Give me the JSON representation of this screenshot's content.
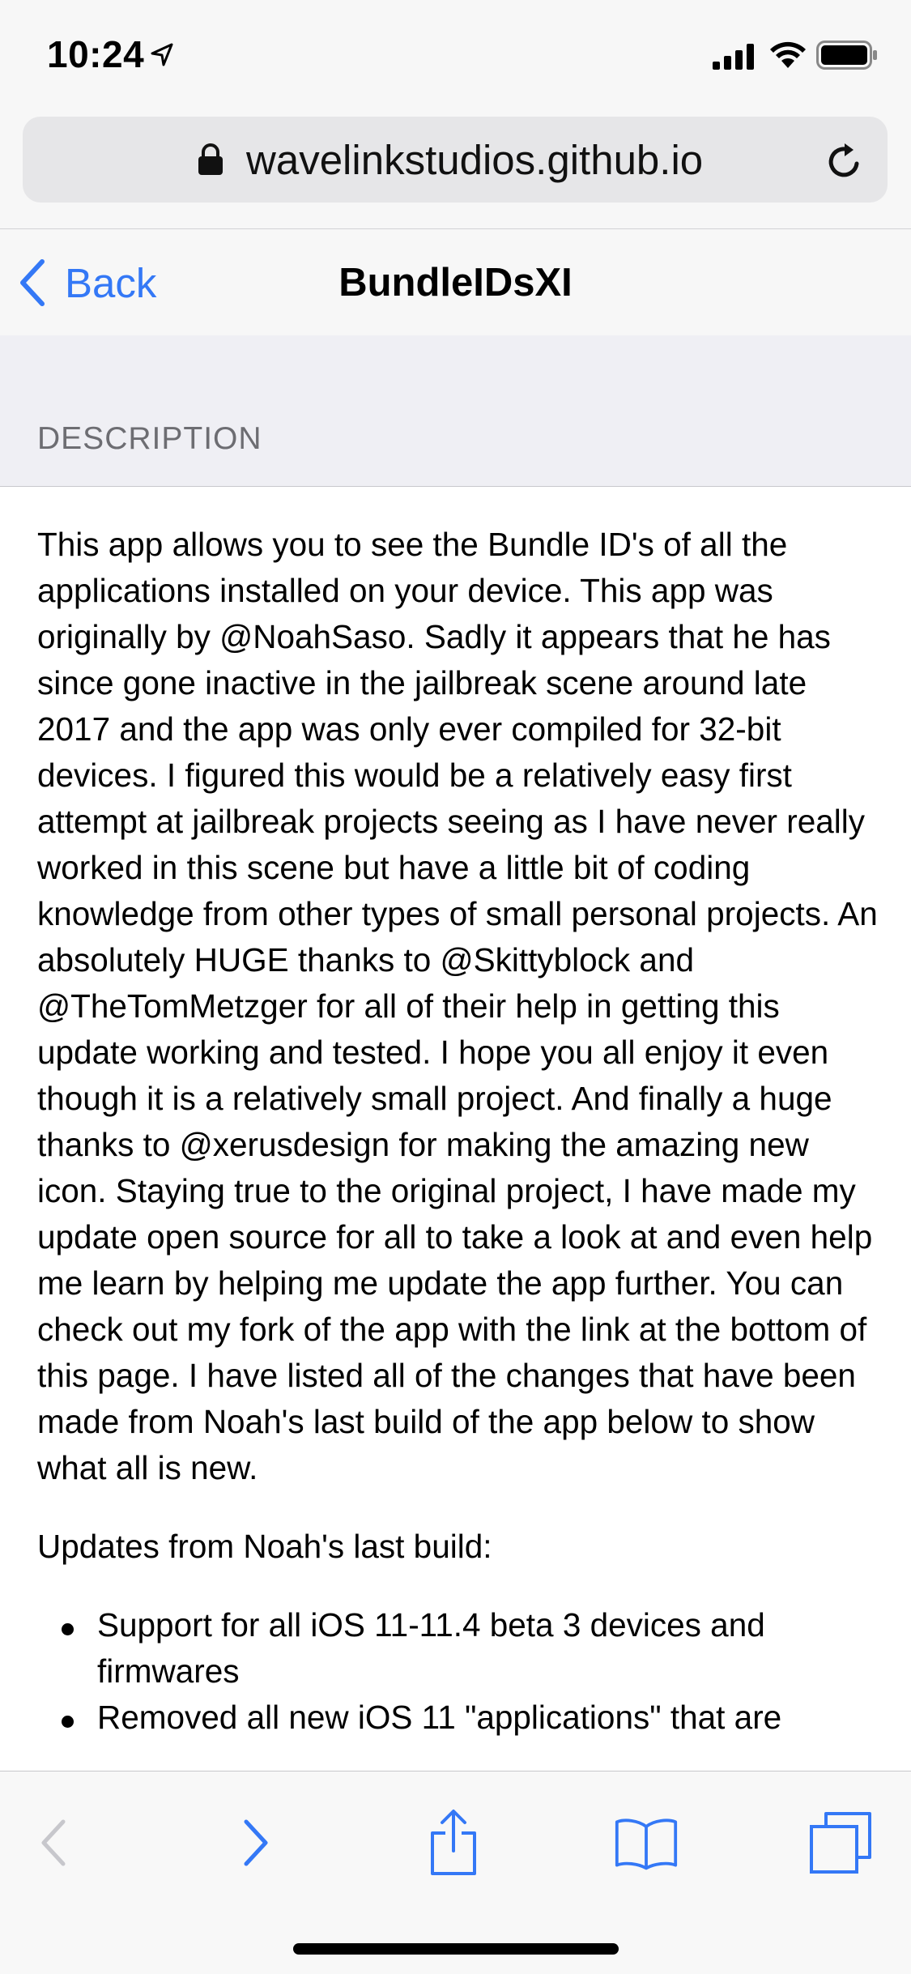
{
  "status_bar": {
    "time": "10:24"
  },
  "browser": {
    "url": "wavelinkstudios.github.io"
  },
  "nav": {
    "back_label": "Back",
    "title": "BundleIDsXI"
  },
  "section": {
    "label": "DESCRIPTION"
  },
  "content": {
    "description": "This app allows you to see the Bundle ID's of all the applications installed on your device. This app was originally by @NoahSaso. Sadly it appears that he has since gone inactive in the jailbreak scene around late 2017 and the app was only ever compiled for 32-bit devices. I figured this would be a relatively easy first attempt at jailbreak projects seeing as I have never really worked in this scene but have a little bit of coding knowledge from other types of small personal projects. An absolutely HUGE thanks to @Skittyblock and @TheTomMetzger for all of their help in getting this update working and tested. I hope you all enjoy it even though it is a relatively small project. And finally a huge thanks to @xerusdesign for making the amazing new icon. Staying true to the original project, I have made my update open source for all to take a look at and even help me learn by helping me update the app further. You can check out my fork of the app with the link at the bottom of this page. I have listed all of the changes that have been made from Noah's last build of the app below to show what all is new.",
    "updates_heading": "Updates from Noah's last build:",
    "updates": [
      "Support for all iOS 11-11.4 beta 3 devices and firmwares",
      "Removed all new iOS 11 \"applications\" that are"
    ]
  },
  "toolbar": {
    "icons": [
      "back-arrow-icon",
      "forward-arrow-icon",
      "share-icon",
      "bookmarks-icon",
      "tabs-icon"
    ]
  },
  "colors": {
    "accent": "#3478f6",
    "disabled": "#c7c7cc",
    "bar_bg": "#f7f7f7",
    "section_bg": "#efeff4"
  }
}
